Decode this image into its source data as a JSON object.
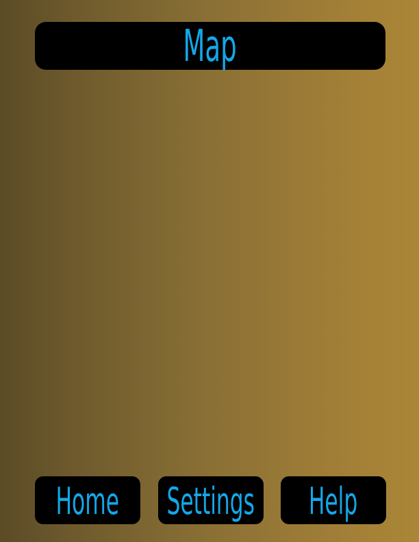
{
  "header": {
    "title": "Map"
  },
  "nav": {
    "home_label": "Home",
    "settings_label": "Settings",
    "help_label": "Help"
  },
  "colors": {
    "text_accent": "#14a7e8",
    "button_background": "#000000",
    "background_gradient_left": "#5b4b26",
    "background_gradient_right": "#aa8637"
  }
}
